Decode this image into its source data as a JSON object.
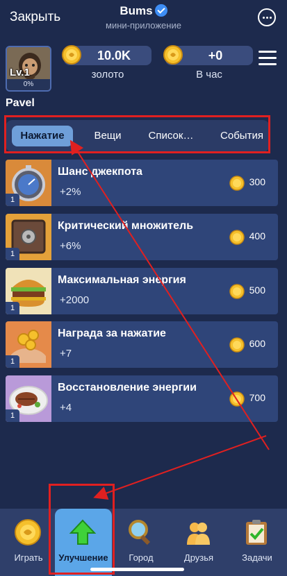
{
  "header": {
    "close_label": "Закрыть",
    "app_name": "Bums",
    "app_subtitle": "мини-приложение"
  },
  "profile": {
    "level": "Lv.1",
    "progress": "0%",
    "username": "Pavel"
  },
  "stats": {
    "gold_value": "10.0K",
    "gold_label": "золото",
    "rate_value": "+0",
    "rate_label": "В час"
  },
  "tabs": [
    {
      "label": "Нажатие",
      "active": true
    },
    {
      "label": "Вещи",
      "active": false
    },
    {
      "label": "Список…",
      "active": false
    },
    {
      "label": "События",
      "active": false
    }
  ],
  "upgrades": [
    {
      "title": "Шанс джекпота",
      "bonus": "+2%",
      "cost": "300",
      "level": "1",
      "icon": "stopwatch-icon"
    },
    {
      "title": "Критический множитель",
      "bonus": "+6%",
      "cost": "400",
      "level": "1",
      "icon": "safe-icon"
    },
    {
      "title": "Максимальная энергия",
      "bonus": "+2000",
      "cost": "500",
      "level": "1",
      "icon": "burger-icon"
    },
    {
      "title": "Награда за нажатие",
      "bonus": "+7",
      "cost": "600",
      "level": "1",
      "icon": "coins-hand-icon"
    },
    {
      "title": "Восстановление энергии",
      "bonus": "+4",
      "cost": "700",
      "level": "1",
      "icon": "steak-plate-icon"
    }
  ],
  "nav": [
    {
      "label": "Играть",
      "icon": "coin-icon",
      "active": false
    },
    {
      "label": "Улучшение",
      "icon": "up-arrow-icon",
      "active": true
    },
    {
      "label": "Город",
      "icon": "magnifier-icon",
      "active": false
    },
    {
      "label": "Друзья",
      "icon": "friends-icon",
      "active": false
    },
    {
      "label": "Задачи",
      "icon": "clipboard-icon",
      "active": false
    }
  ],
  "colors": {
    "background": "#1d2a4d",
    "card": "#2f4579",
    "active_tab": "#6f9fd9",
    "annotation_red": "#e02020",
    "coin_gold": "#f5c02c"
  }
}
